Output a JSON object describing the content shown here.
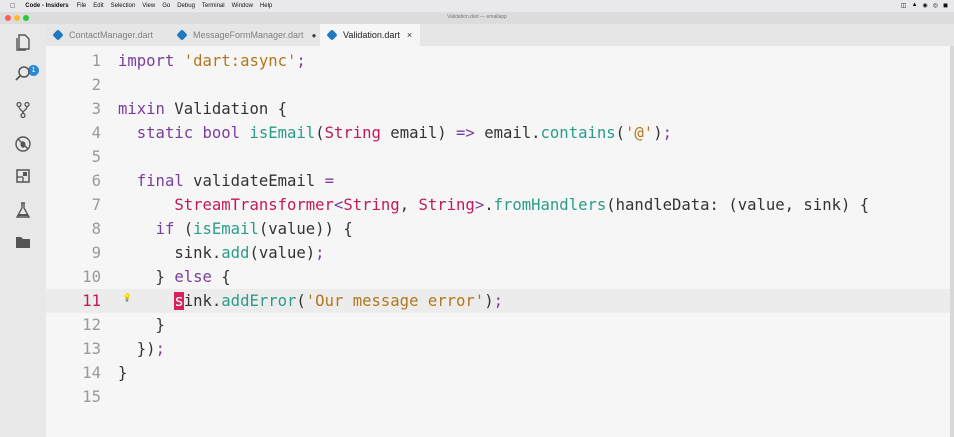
{
  "menubar": {
    "app_name": "Code - Insiders",
    "items": [
      "File",
      "Edit",
      "Selection",
      "View",
      "Go",
      "Debug",
      "Terminal",
      "Window",
      "Help"
    ]
  },
  "window": {
    "title": "Validation.dart — emailapp"
  },
  "activity_bar": {
    "items": [
      "files-icon",
      "search-icon",
      "source-control-icon",
      "debug-icon",
      "extensions-icon",
      "test-icon",
      "folder-icon"
    ],
    "badge": "1"
  },
  "tabs": [
    {
      "label": "ContactManager.dart",
      "state": "inactive"
    },
    {
      "label": "MessageFormManager.dart",
      "state": "modified",
      "indicator": "●"
    },
    {
      "label": "Validation.dart",
      "state": "active",
      "close": "×"
    }
  ],
  "editor": {
    "current_line": 11,
    "lines": [
      {
        "n": "1",
        "text": "import 'dart:async';"
      },
      {
        "n": "2",
        "text": ""
      },
      {
        "n": "3",
        "text": "mixin Validation {"
      },
      {
        "n": "4",
        "text": "  static bool isEmail(String email) => email.contains('@');"
      },
      {
        "n": "5",
        "text": ""
      },
      {
        "n": "6",
        "text": "  final validateEmail ="
      },
      {
        "n": "7",
        "text": "      StreamTransformer<String, String>.fromHandlers(handleData: (value, sink) {"
      },
      {
        "n": "8",
        "text": "    if (isEmail(value)) {"
      },
      {
        "n": "9",
        "text": "      sink.add(value);"
      },
      {
        "n": "10",
        "text": "    } else {"
      },
      {
        "n": "11",
        "text": "      sink.addError('Our message error');"
      },
      {
        "n": "12",
        "text": "    }"
      },
      {
        "n": "13",
        "text": "  });"
      },
      {
        "n": "14",
        "text": "}"
      },
      {
        "n": "15",
        "text": ""
      }
    ]
  },
  "colors": {
    "keyword": "#7a3e9d",
    "type": "#c2185b",
    "method": "#2a9c8a",
    "string": "#b2771c",
    "cursor": "#d6215a",
    "dart_icon": "#1e78c2"
  }
}
